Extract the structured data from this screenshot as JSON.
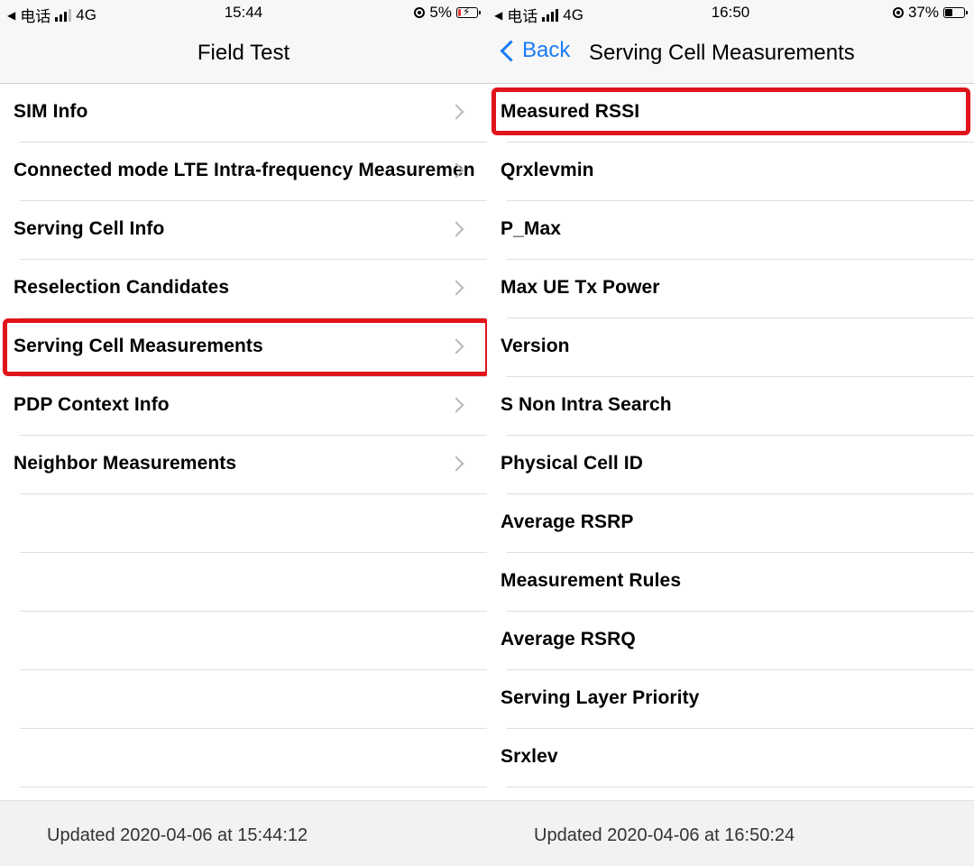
{
  "left": {
    "status": {
      "carrier": "电话",
      "network": "4G",
      "time": "15:44",
      "battery": "5%"
    },
    "nav": {
      "title": "Field Test"
    },
    "items": [
      "SIM Info",
      "Connected mode LTE Intra-frequency Measuremen",
      "Serving Cell Info",
      "Reselection Candidates",
      "Serving Cell Measurements",
      "PDP Context Info",
      "Neighbor Measurements"
    ],
    "footer": "Updated 2020-04-06 at 15:44:12",
    "highlight_color": "#e0141b"
  },
  "right": {
    "status": {
      "carrier": "电话",
      "network": "4G",
      "time": "16:50",
      "battery": "37%"
    },
    "nav": {
      "back": "Back",
      "title": "Serving Cell Measurements"
    },
    "items": [
      "Measured RSSI",
      "Qrxlevmin",
      "P_Max",
      "Max UE Tx Power",
      "Version",
      "S Non Intra Search",
      "Physical Cell ID",
      "Average RSRP",
      "Measurement Rules",
      "Average RSRQ",
      "Serving Layer Priority",
      "Srxlev"
    ],
    "footer": "Updated 2020-04-06 at 16:50:24",
    "accent_color": "#1a7cf5"
  }
}
